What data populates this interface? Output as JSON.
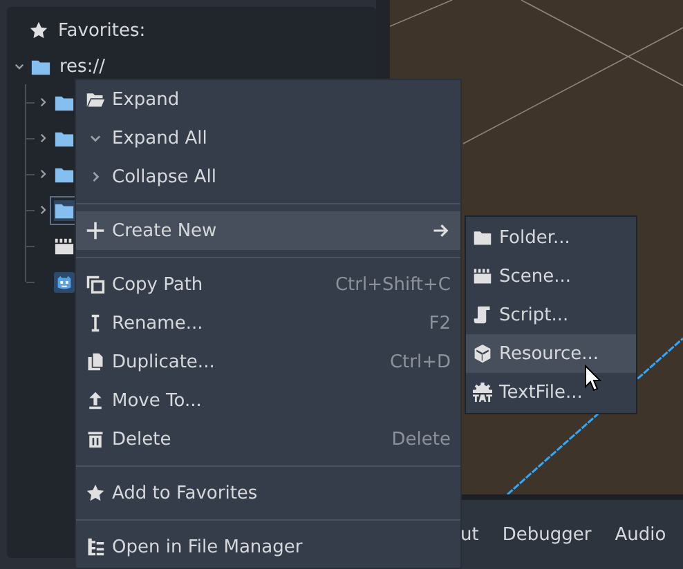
{
  "tree": {
    "favorites": {
      "label": "Favorites:"
    },
    "root": {
      "label": "res://",
      "expanded": true,
      "children": [
        {
          "kind": "folder",
          "expanded": false,
          "selected": false
        },
        {
          "kind": "folder",
          "expanded": false,
          "selected": false
        },
        {
          "kind": "folder",
          "expanded": false,
          "selected": false
        },
        {
          "kind": "folder",
          "expanded": false,
          "selected": true
        },
        {
          "kind": "scene",
          "selected": false
        },
        {
          "kind": "engine-logo",
          "selected": false
        }
      ]
    }
  },
  "context_menu": {
    "items": [
      {
        "kind": "item",
        "label": "Expand",
        "hovered": false
      },
      {
        "kind": "item",
        "label": "Expand All",
        "hovered": false
      },
      {
        "kind": "item",
        "label": "Collapse All",
        "hovered": false
      },
      {
        "kind": "separator"
      },
      {
        "kind": "submenu",
        "label": "Create New",
        "hovered": true
      },
      {
        "kind": "separator"
      },
      {
        "kind": "item",
        "label": "Copy Path",
        "shortcut": "Ctrl+Shift+C",
        "hovered": false
      },
      {
        "kind": "item",
        "label": "Rename...",
        "shortcut": "F2",
        "hovered": false
      },
      {
        "kind": "item",
        "label": "Duplicate...",
        "shortcut": "Ctrl+D",
        "hovered": false
      },
      {
        "kind": "item",
        "label": "Move To...",
        "hovered": false
      },
      {
        "kind": "item",
        "label": "Delete",
        "shortcut": "Delete",
        "hovered": false
      },
      {
        "kind": "separator"
      },
      {
        "kind": "item",
        "label": "Add to Favorites",
        "hovered": false
      },
      {
        "kind": "separator"
      },
      {
        "kind": "item",
        "label": "Open in File Manager",
        "hovered": false
      }
    ]
  },
  "submenu": {
    "items": [
      {
        "label": "Folder...",
        "hovered": false
      },
      {
        "label": "Scene...",
        "hovered": false
      },
      {
        "label": "Script...",
        "hovered": false
      },
      {
        "label": "Resource...",
        "hovered": true
      },
      {
        "label": "TextFile...",
        "hovered": false
      }
    ]
  },
  "bottom_tabs": [
    {
      "label": "ut"
    },
    {
      "label": "Debugger"
    },
    {
      "label": "Audio"
    }
  ]
}
